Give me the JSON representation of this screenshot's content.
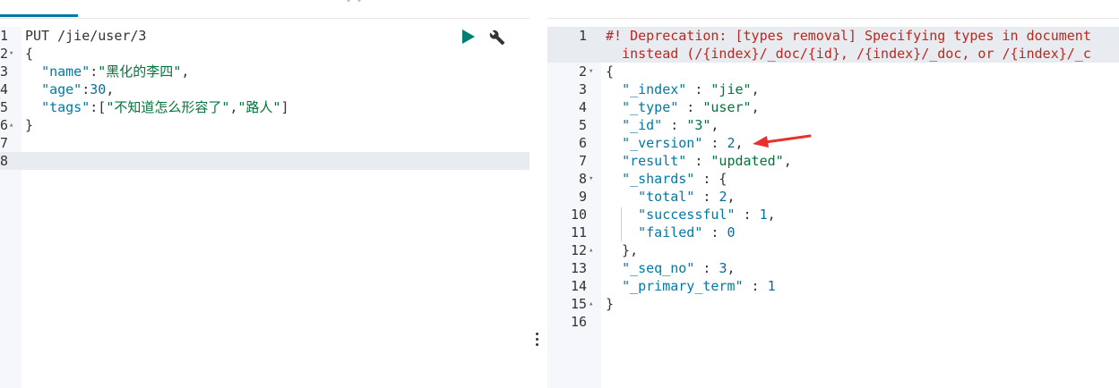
{
  "request": {
    "lines": [
      {
        "num": "1",
        "fold": "",
        "parts": [
          [
            "m",
            "PUT /jie/user/3"
          ]
        ]
      },
      {
        "num": "2",
        "fold": "▾",
        "parts": [
          [
            "m",
            "{"
          ]
        ]
      },
      {
        "num": "3",
        "fold": "",
        "parts": [
          [
            "m",
            "  "
          ],
          [
            "k",
            "\"name\""
          ],
          [
            "m",
            ":"
          ],
          [
            "s",
            "\"黑化的李四\""
          ],
          [
            "m",
            ","
          ]
        ]
      },
      {
        "num": "4",
        "fold": "",
        "parts": [
          [
            "m",
            "  "
          ],
          [
            "k",
            "\"age\""
          ],
          [
            "m",
            ":"
          ],
          [
            "num",
            "30"
          ],
          [
            "m",
            ","
          ]
        ]
      },
      {
        "num": "5",
        "fold": "",
        "parts": [
          [
            "m",
            "  "
          ],
          [
            "k",
            "\"tags\""
          ],
          [
            "m",
            ":["
          ],
          [
            "s",
            "\"不知道怎么形容了\""
          ],
          [
            "m",
            ","
          ],
          [
            "s",
            "\"路人\""
          ],
          [
            "m",
            "]"
          ]
        ]
      },
      {
        "num": "6",
        "fold": "▴",
        "parts": [
          [
            "m",
            "}"
          ]
        ]
      },
      {
        "num": "7",
        "fold": "",
        "parts": []
      },
      {
        "num": "8",
        "fold": "",
        "parts": [],
        "active": true
      }
    ]
  },
  "response": {
    "lines": [
      {
        "num": "1",
        "fold": "",
        "parts": [
          [
            "cm",
            "#! Deprecation: [types removal] Specifying types in document"
          ]
        ],
        "active": true
      },
      {
        "num": "",
        "fold": "",
        "parts": [
          [
            "cm",
            "  instead (/{index}/_doc/{id}, /{index}/_doc, or /{index}/_c"
          ]
        ],
        "active": true
      },
      {
        "num": "2",
        "fold": "▾",
        "parts": [
          [
            "m",
            "{"
          ]
        ]
      },
      {
        "num": "3",
        "fold": "",
        "parts": [
          [
            "m",
            "  "
          ],
          [
            "k",
            "\"_index\""
          ],
          [
            "m",
            " : "
          ],
          [
            "s",
            "\"jie\""
          ],
          [
            "m",
            ","
          ]
        ]
      },
      {
        "num": "4",
        "fold": "",
        "parts": [
          [
            "m",
            "  "
          ],
          [
            "k",
            "\"_type\""
          ],
          [
            "m",
            " : "
          ],
          [
            "s",
            "\"user\""
          ],
          [
            "m",
            ","
          ]
        ]
      },
      {
        "num": "5",
        "fold": "",
        "parts": [
          [
            "m",
            "  "
          ],
          [
            "k",
            "\"_id\""
          ],
          [
            "m",
            " : "
          ],
          [
            "s",
            "\"3\""
          ],
          [
            "m",
            ","
          ]
        ]
      },
      {
        "num": "6",
        "fold": "",
        "parts": [
          [
            "m",
            "  "
          ],
          [
            "k",
            "\"_version\""
          ],
          [
            "m",
            " : "
          ],
          [
            "num",
            "2"
          ],
          [
            "m",
            ","
          ]
        ]
      },
      {
        "num": "7",
        "fold": "",
        "parts": [
          [
            "m",
            "  "
          ],
          [
            "k",
            "\"result\""
          ],
          [
            "m",
            " : "
          ],
          [
            "s",
            "\"updated\""
          ],
          [
            "m",
            ","
          ]
        ]
      },
      {
        "num": "8",
        "fold": "▾",
        "parts": [
          [
            "m",
            "  "
          ],
          [
            "k",
            "\"_shards\""
          ],
          [
            "m",
            " : {"
          ]
        ]
      },
      {
        "num": "9",
        "fold": "",
        "parts": [
          [
            "m",
            "    "
          ],
          [
            "k",
            "\"total\""
          ],
          [
            "m",
            " : "
          ],
          [
            "num",
            "2"
          ],
          [
            "m",
            ","
          ]
        ]
      },
      {
        "num": "10",
        "fold": "",
        "parts": [
          [
            "m",
            "    "
          ],
          [
            "k",
            "\"successful\""
          ],
          [
            "m",
            " : "
          ],
          [
            "num",
            "1"
          ],
          [
            "m",
            ","
          ]
        ]
      },
      {
        "num": "11",
        "fold": "",
        "parts": [
          [
            "m",
            "    "
          ],
          [
            "k",
            "\"failed\""
          ],
          [
            "m",
            " : "
          ],
          [
            "num",
            "0"
          ]
        ]
      },
      {
        "num": "12",
        "fold": "▴",
        "parts": [
          [
            "m",
            "  },"
          ]
        ]
      },
      {
        "num": "13",
        "fold": "",
        "parts": [
          [
            "m",
            "  "
          ],
          [
            "k",
            "\"_seq_no\""
          ],
          [
            "m",
            " : "
          ],
          [
            "num",
            "3"
          ],
          [
            "m",
            ","
          ]
        ]
      },
      {
        "num": "14",
        "fold": "",
        "parts": [
          [
            "m",
            "  "
          ],
          [
            "k",
            "\"_primary_term\""
          ],
          [
            "m",
            " : "
          ],
          [
            "num",
            "1"
          ]
        ]
      },
      {
        "num": "15",
        "fold": "▴",
        "parts": [
          [
            "m",
            "}"
          ]
        ]
      },
      {
        "num": "16",
        "fold": "",
        "parts": []
      }
    ]
  },
  "icons": {
    "run": "play-icon",
    "settings": "wrench-icon",
    "resize": "grip-icon",
    "annotation": "red-arrow-icon"
  },
  "colors": {
    "key": "#0079a5",
    "string": "#00753a",
    "number": "#0c6c9c",
    "comment": "#bd271e",
    "play": "#017d73",
    "arrow": "#e8302c"
  }
}
